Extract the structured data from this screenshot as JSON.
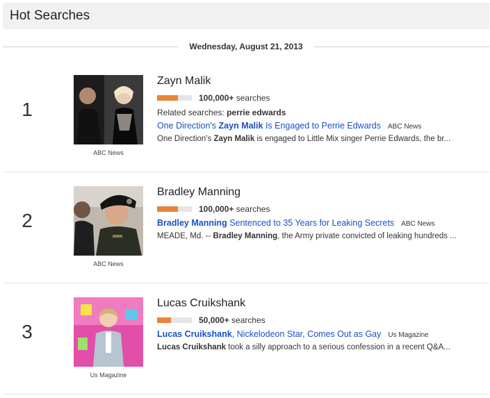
{
  "header": {
    "title": "Hot Searches"
  },
  "date": "Wednesday, August 21, 2013",
  "colors": {
    "bar_fill": "#e8843a",
    "bar_track": "#e5e5e5",
    "link": "#1a4fc4"
  },
  "items": [
    {
      "rank": "1",
      "title": "Zayn Malik",
      "volume": "100,000+",
      "volume_suffix": " searches",
      "volume_level": 0.6,
      "related_label": "Related searches: ",
      "related_value": "perrie edwards",
      "news_link_pre": "One Direction's ",
      "news_link_bold": "Zayn Malik",
      "news_link_post": " Is Engaged to Perrie Edwards",
      "news_source": "ABC News",
      "snippet_pre": "One Direction's ",
      "snippet_bold": "Zayn Malik",
      "snippet_post": " is engaged to Little Mix singer Perrie Edwards, the br...",
      "image_source": "ABC News"
    },
    {
      "rank": "2",
      "title": "Bradley Manning",
      "volume": "100,000+",
      "volume_suffix": " searches",
      "volume_level": 0.6,
      "news_link_pre": "",
      "news_link_bold": "Bradley Manning",
      "news_link_post": " Sentenced to 35 Years for Leaking Secrets",
      "news_source": "ABC News",
      "snippet_pre": "MEADE, Md. -- ",
      "snippet_bold": "Bradley Manning",
      "snippet_post": ", the Army private convicted of leaking hundreds ...",
      "image_source": "ABC News"
    },
    {
      "rank": "3",
      "title": "Lucas Cruikshank",
      "volume": "50,000+",
      "volume_suffix": " searches",
      "volume_level": 0.4,
      "news_link_pre": "",
      "news_link_bold": "Lucas Cruikshank",
      "news_link_post": ", Nickelodeon Star, Comes Out as Gay",
      "news_source": "Us Magazine",
      "snippet_pre": "",
      "snippet_bold": "Lucas Cruikshank",
      "snippet_post": " took a silly approach to a serious confession in a recent Q&A...",
      "image_source": "Us Magazine"
    }
  ]
}
